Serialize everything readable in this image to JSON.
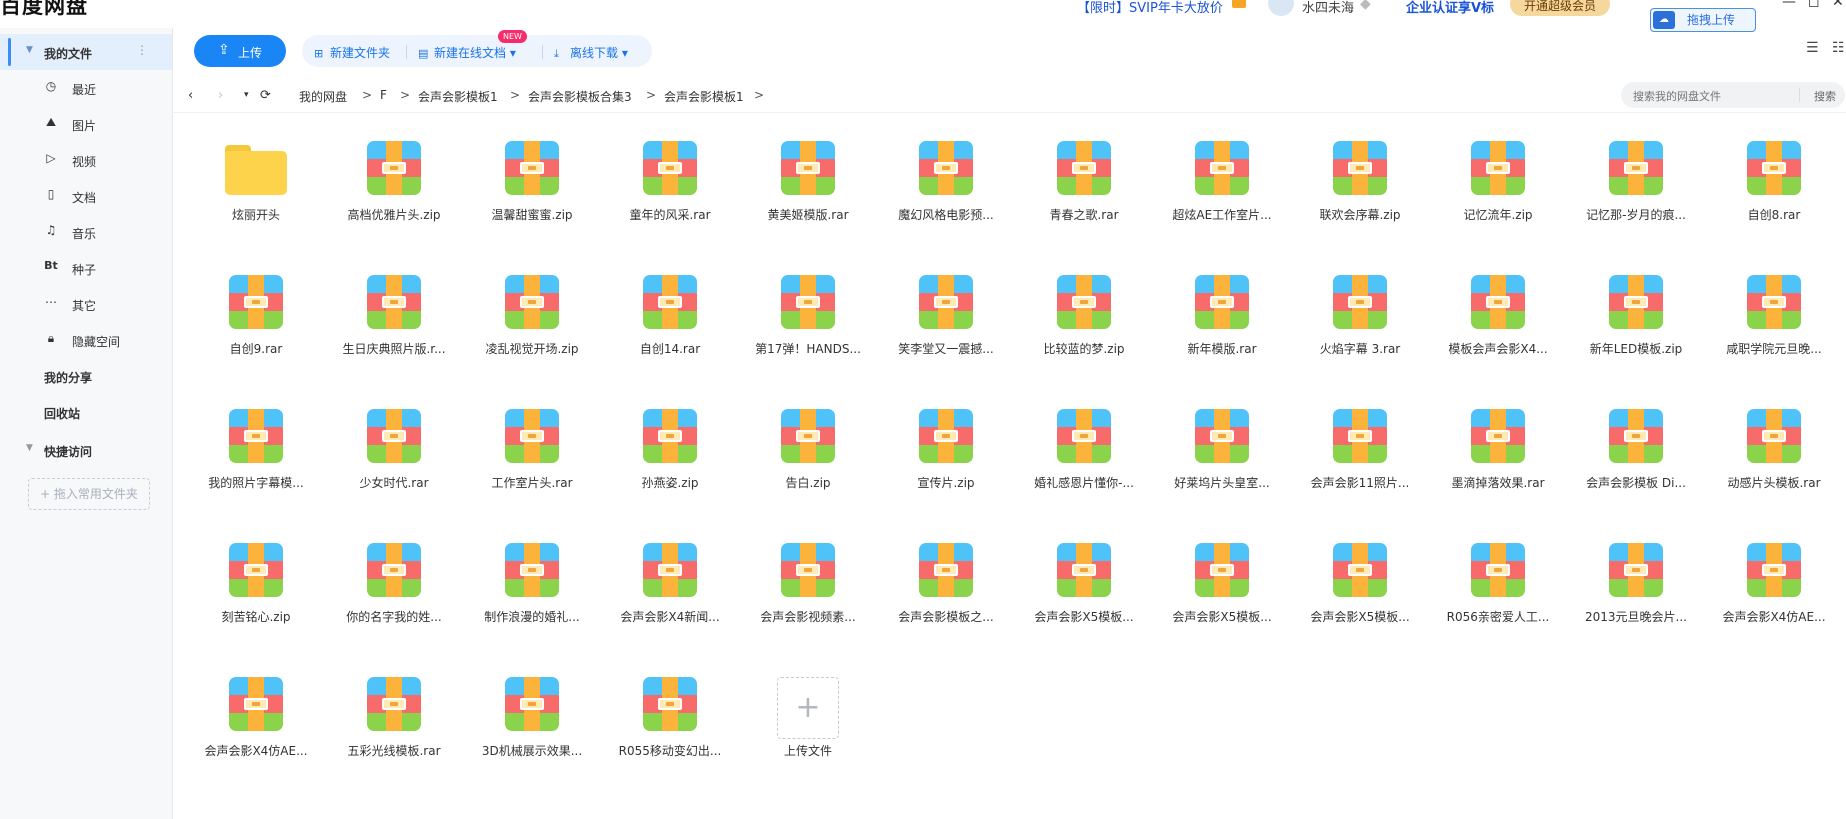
{
  "topbar": {
    "app_title": "百度网盘",
    "promo": "【限时】SVIP年卡大放价",
    "username": "水四未海",
    "enterprise": "企业认证享V标",
    "svip_button": "开通超级会员",
    "drag_upload": "拖拽上传",
    "win_min": "—",
    "win_max": "◻",
    "win_close": "✕"
  },
  "sidebar": {
    "my_files": "我的文件",
    "items": [
      {
        "label": "最近",
        "icon": "clock-icon"
      },
      {
        "label": "图片",
        "icon": "image-icon"
      },
      {
        "label": "视频",
        "icon": "play-icon"
      },
      {
        "label": "文档",
        "icon": "doc-icon"
      },
      {
        "label": "音乐",
        "icon": "headphone-icon"
      },
      {
        "label": "种子",
        "icon": "bt-icon"
      },
      {
        "label": "其它",
        "icon": "more-icon"
      },
      {
        "label": "隐藏空间",
        "icon": "lock-icon"
      }
    ],
    "my_share": "我的分享",
    "recycle_bin": "回收站",
    "quick_access": "快捷访问",
    "pin_folder": "+ 拖入常用文件夹",
    "bt_glyph": "Bt"
  },
  "toolbar": {
    "upload": "上传",
    "new_folder": "新建文件夹",
    "new_online_doc": "新建在线文档",
    "offline_download": "离线下载",
    "new_badge": "NEW"
  },
  "breadcrumb": [
    "我的网盘",
    "F",
    "会声会影模板1",
    "会声会影模板合集3",
    "会声会影模板1"
  ],
  "search": {
    "placeholder": "搜索我的网盘文件",
    "button": "搜索"
  },
  "files": [
    {
      "name": "炫丽开头",
      "type": "folder"
    },
    {
      "name": "高档优雅片头.zip",
      "type": "zip"
    },
    {
      "name": "温馨甜蜜蜜.zip",
      "type": "zip"
    },
    {
      "name": "童年的风采.rar",
      "type": "zip"
    },
    {
      "name": "黄美姬模版.rar",
      "type": "zip"
    },
    {
      "name": "魔幻风格电影预...",
      "type": "zip"
    },
    {
      "name": "青春之歌.rar",
      "type": "zip"
    },
    {
      "name": "超炫AE工作室片...",
      "type": "zip"
    },
    {
      "name": "联欢会序幕.zip",
      "type": "zip"
    },
    {
      "name": "记忆流年.zip",
      "type": "zip"
    },
    {
      "name": "记忆那-岁月的痕...",
      "type": "zip"
    },
    {
      "name": "自创8.rar",
      "type": "zip"
    },
    {
      "name": "自创9.rar",
      "type": "zip"
    },
    {
      "name": "生日庆典照片版.r...",
      "type": "zip"
    },
    {
      "name": "凌乱视觉开场.zip",
      "type": "zip"
    },
    {
      "name": "自创14.rar",
      "type": "zip"
    },
    {
      "name": "第17弹！HANDS...",
      "type": "zip"
    },
    {
      "name": "笑李堂又一震撼...",
      "type": "zip"
    },
    {
      "name": "比较蓝的梦.zip",
      "type": "zip"
    },
    {
      "name": "新年模版.rar",
      "type": "zip"
    },
    {
      "name": "火焰字幕 3.rar",
      "type": "zip"
    },
    {
      "name": "模板会声会影X4...",
      "type": "zip"
    },
    {
      "name": "新年LED模板.zip",
      "type": "zip"
    },
    {
      "name": "咸职学院元旦晚...",
      "type": "zip"
    },
    {
      "name": "我的照片字幕模...",
      "type": "zip"
    },
    {
      "name": "少女时代.rar",
      "type": "zip"
    },
    {
      "name": "工作室片头.rar",
      "type": "zip"
    },
    {
      "name": "孙燕姿.zip",
      "type": "zip"
    },
    {
      "name": "告白.zip",
      "type": "zip"
    },
    {
      "name": "宣传片.zip",
      "type": "zip"
    },
    {
      "name": "婚礼感恩片懂你-...",
      "type": "zip"
    },
    {
      "name": "好莱坞片头皇室...",
      "type": "zip"
    },
    {
      "name": "会声会影11照片...",
      "type": "zip"
    },
    {
      "name": "墨滴掉落效果.rar",
      "type": "zip"
    },
    {
      "name": "会声会影模板 Di...",
      "type": "zip"
    },
    {
      "name": "动感片头模板.rar",
      "type": "zip"
    },
    {
      "name": "刻苦铭心.zip",
      "type": "zip"
    },
    {
      "name": "你的名字我的姓...",
      "type": "zip"
    },
    {
      "name": "制作浪漫的婚礼...",
      "type": "zip"
    },
    {
      "name": "会声会影X4新闻...",
      "type": "zip"
    },
    {
      "name": "会声会影视频素...",
      "type": "zip"
    },
    {
      "name": "会声会影模板之...",
      "type": "zip"
    },
    {
      "name": "会声会影X5模板...",
      "type": "zip"
    },
    {
      "name": "会声会影X5模板...",
      "type": "zip"
    },
    {
      "name": "会声会影X5模板...",
      "type": "zip"
    },
    {
      "name": "R056亲密爱人工...",
      "type": "zip"
    },
    {
      "name": "2013元旦晚会片...",
      "type": "zip"
    },
    {
      "name": "会声会影X4仿AE...",
      "type": "zip"
    },
    {
      "name": "会声会影X4仿AE...",
      "type": "zip"
    },
    {
      "name": "五彩光线模板.rar",
      "type": "zip"
    },
    {
      "name": "3D机械展示效果...",
      "type": "zip"
    },
    {
      "name": "R055移动变幻出...",
      "type": "zip"
    },
    {
      "name": "上传文件",
      "type": "upload"
    }
  ],
  "colors": {
    "accent": "#1a86f5",
    "sidebar_active": "#e4effd",
    "folder": "#fcd34a"
  }
}
